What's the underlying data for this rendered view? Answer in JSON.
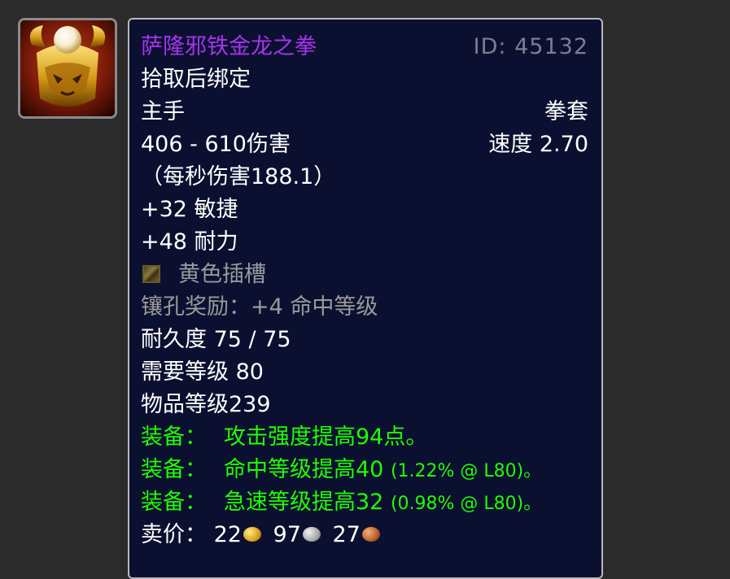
{
  "item": {
    "name": "萨隆邪铁金龙之拳",
    "id_label": "ID: 45132",
    "bind": "拾取后绑定",
    "slot": "主手",
    "type": "拳套",
    "damage": "406 - 610伤害",
    "speed": "速度 2.70",
    "dps": "（每秒伤害188.1）",
    "stat_agility": "+32 敏捷",
    "stat_stamina": "+48 耐力",
    "socket": "黄色插槽",
    "socket_bonus": "镶孔奖励：+4 命中等级",
    "durability": "耐久度 75 / 75",
    "required_level": "需要等级 80",
    "item_level": "物品等级239",
    "equip_label": "装备：",
    "equip_1": "攻击强度提高94点。",
    "equip_2_text": "命中等级提高40",
    "equip_2_detail": "(1.22% @ L80)。",
    "equip_3_text": "急速等级提高32",
    "equip_3_detail": "(0.98% @ L80)。",
    "sell_label": "卖价：",
    "sell_gold": "22",
    "sell_silver": "97",
    "sell_copper": "27"
  },
  "colors": {
    "epic": "#a335ee",
    "green": "#1eff00",
    "tooltip_bg": "#0c1030"
  },
  "icons": {
    "item_icon": "golden-dragon-fist-icon",
    "socket_icon": "yellow-socket-icon",
    "gold": "gold-coin-icon",
    "silver": "silver-coin-icon",
    "copper": "copper-coin-icon"
  }
}
